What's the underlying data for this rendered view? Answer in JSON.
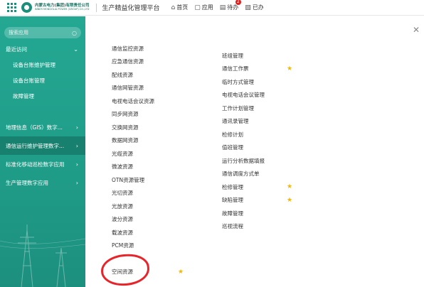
{
  "header": {
    "logo_cn": "内蒙古电力(集团)有限责任公司",
    "logo_en": "INNER MONGOLIA POWER (GROUP) CO.,LTD",
    "platform_title": "生产精益化管理平台",
    "nav": [
      {
        "label": "首页",
        "icon": "home-icon"
      },
      {
        "label": "应用",
        "icon": "app-icon"
      },
      {
        "label": "待办",
        "icon": "todo-icon",
        "badge": "2"
      },
      {
        "label": "已办",
        "icon": "done-icon"
      }
    ]
  },
  "sidebar": {
    "search_placeholder": "搜索应用",
    "recent_label": "最近访问",
    "recent_items": [
      "设备台账维护管理",
      "设备台账管理",
      "故障管理"
    ],
    "categories": [
      "地理信息（GIS）数字...",
      "通信运行维护管理数字...",
      "标准化移动巡检数字应用",
      "生产管理数字应用"
    ]
  },
  "menu": {
    "col1": [
      {
        "label": "通信监控资源",
        "starred": false
      },
      {
        "label": "应急通信资源",
        "starred": false
      },
      {
        "label": "配线资源",
        "starred": false
      },
      {
        "label": "通信网管资源",
        "starred": false
      },
      {
        "label": "电视电话会议资源",
        "starred": false
      },
      {
        "label": "同步网资源",
        "starred": false
      },
      {
        "label": "交换网资源",
        "starred": false
      },
      {
        "label": "数据网资源",
        "starred": false
      },
      {
        "label": "光缆资源",
        "starred": false
      },
      {
        "label": "微波资源",
        "starred": false
      },
      {
        "label": "OTN资源管理",
        "starred": false
      },
      {
        "label": "光切资源",
        "starred": false
      },
      {
        "label": "光放资源",
        "starred": false
      },
      {
        "label": "波分资源",
        "starred": false
      },
      {
        "label": "载波资源",
        "starred": false
      },
      {
        "label": "PCM资源",
        "starred": false
      },
      {
        "label": "",
        "starred": false
      },
      {
        "label": "空间资源",
        "starred": true
      }
    ],
    "col2": [
      {
        "label": "班组管理",
        "starred": false
      },
      {
        "label": "通信工作票",
        "starred": true
      },
      {
        "label": "临时方式管理",
        "starred": false
      },
      {
        "label": "电视电话会议管理",
        "starred": false
      },
      {
        "label": "工作计划管理",
        "starred": false
      },
      {
        "label": "通讯录管理",
        "starred": false
      },
      {
        "label": "检修计划",
        "starred": false
      },
      {
        "label": "值班管理",
        "starred": false
      },
      {
        "label": "运行分析数据填报",
        "starred": false
      },
      {
        "label": "通信调度方式单",
        "starred": false
      },
      {
        "label": "检修管理",
        "starred": true
      },
      {
        "label": "缺陷管理",
        "starred": true
      },
      {
        "label": "故障管理",
        "starred": false
      },
      {
        "label": "巡视流程",
        "starred": false
      }
    ]
  },
  "colors": {
    "sidebar_green": "#1f9c88",
    "active_item": "#17806f",
    "star": "#f5b800",
    "annotation_circle": "#e8242b"
  }
}
